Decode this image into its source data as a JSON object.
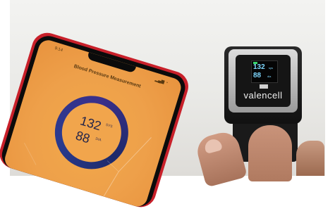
{
  "phone": {
    "status_time": "9:14",
    "status_icons": "▂▄▆ ◔",
    "title": "Blood Pressure Measurement",
    "systolic": "132",
    "systolic_unit": "SYS",
    "diastolic": "88",
    "diastolic_unit": "DIA"
  },
  "oximeter": {
    "value1": "132",
    "unit1": "sys",
    "value2": "88",
    "unit2": "dia",
    "brand": "valencell"
  },
  "colors": {
    "phone_case": "#c8202a",
    "screen_bg": "#eea04a",
    "ring": "#2a3b8f",
    "display_text": "#7fd8ff"
  }
}
